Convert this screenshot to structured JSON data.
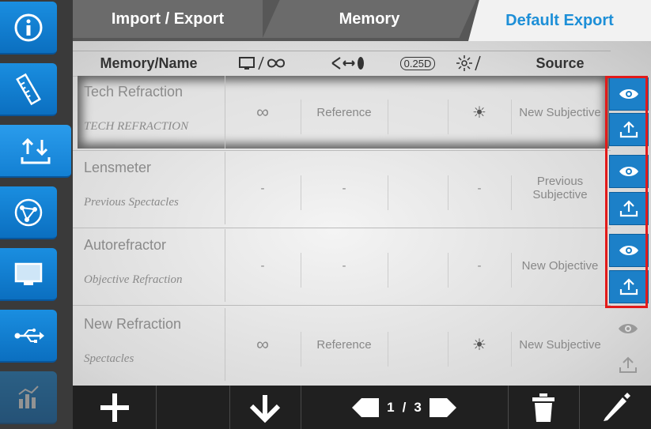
{
  "tabs": [
    {
      "label": "Import / Export"
    },
    {
      "label": "Memory"
    },
    {
      "label": "Default Export"
    }
  ],
  "columns": {
    "name": "Memory/Name",
    "source": "Source",
    "step": "0.25D"
  },
  "rows": [
    {
      "name": "Tech Refraction",
      "subtitle": "TECH REFRACTION",
      "distance": "∞",
      "reference": "Reference",
      "extra": "",
      "light": "☀",
      "source": "New Subjective"
    },
    {
      "name": "Lensmeter",
      "subtitle": "Previous Spectacles",
      "distance": "-",
      "reference": "-",
      "extra": "",
      "light": "-",
      "source": "Previous Subjective"
    },
    {
      "name": "Autorefractor",
      "subtitle": "Objective Refraction",
      "distance": "-",
      "reference": "-",
      "extra": "",
      "light": "-",
      "source": "New Objective"
    },
    {
      "name": "New Refraction",
      "subtitle": "Spectacles",
      "distance": "∞",
      "reference": "Reference",
      "extra": "",
      "light": "☀",
      "source": "New Subjective"
    }
  ],
  "pager": {
    "current": "1",
    "sep": "/",
    "total": "3"
  },
  "colors": {
    "accent": "#1d8fd7",
    "button": "#1c80c8",
    "highlight": "#e21a1a"
  }
}
